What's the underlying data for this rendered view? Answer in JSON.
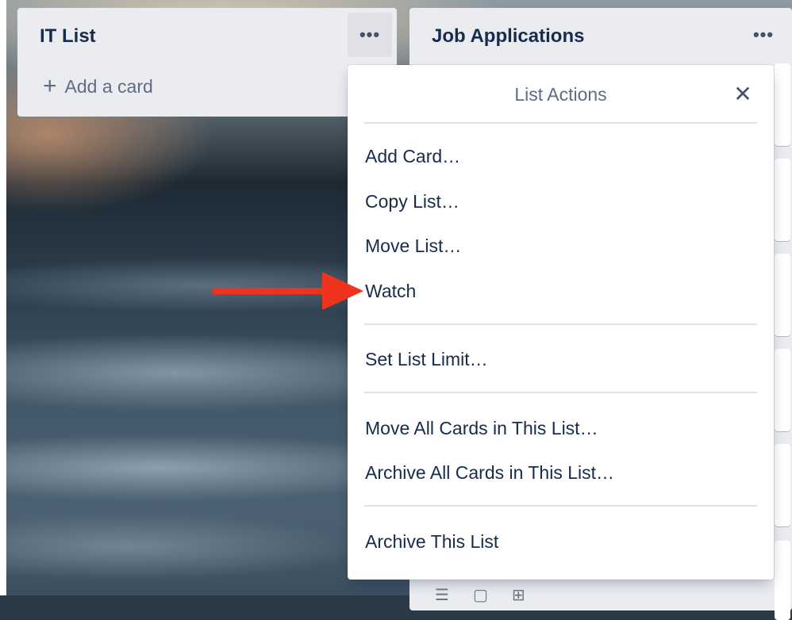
{
  "lists": {
    "it": {
      "title": "IT List",
      "menu_icon": "more-horizontal-icon",
      "add_card_label": "Add a card"
    },
    "job": {
      "title": "Job Applications",
      "menu_icon": "more-horizontal-icon"
    }
  },
  "popover": {
    "title": "List Actions",
    "close_icon": "close-icon",
    "groups": [
      [
        "Add Card…",
        "Copy List…",
        "Move List…",
        "Watch"
      ],
      [
        "Set List Limit…"
      ],
      [
        "Move All Cards in This List…",
        "Archive All Cards in This List…"
      ],
      [
        "Archive This List"
      ]
    ]
  },
  "annotation": {
    "arrow_color": "#f0331f",
    "points_to": "Watch"
  },
  "colors": {
    "list_bg": "#ebecf0",
    "text_primary": "#172b4d",
    "text_muted": "#5e6c84",
    "divider": "#dfe1e6"
  }
}
